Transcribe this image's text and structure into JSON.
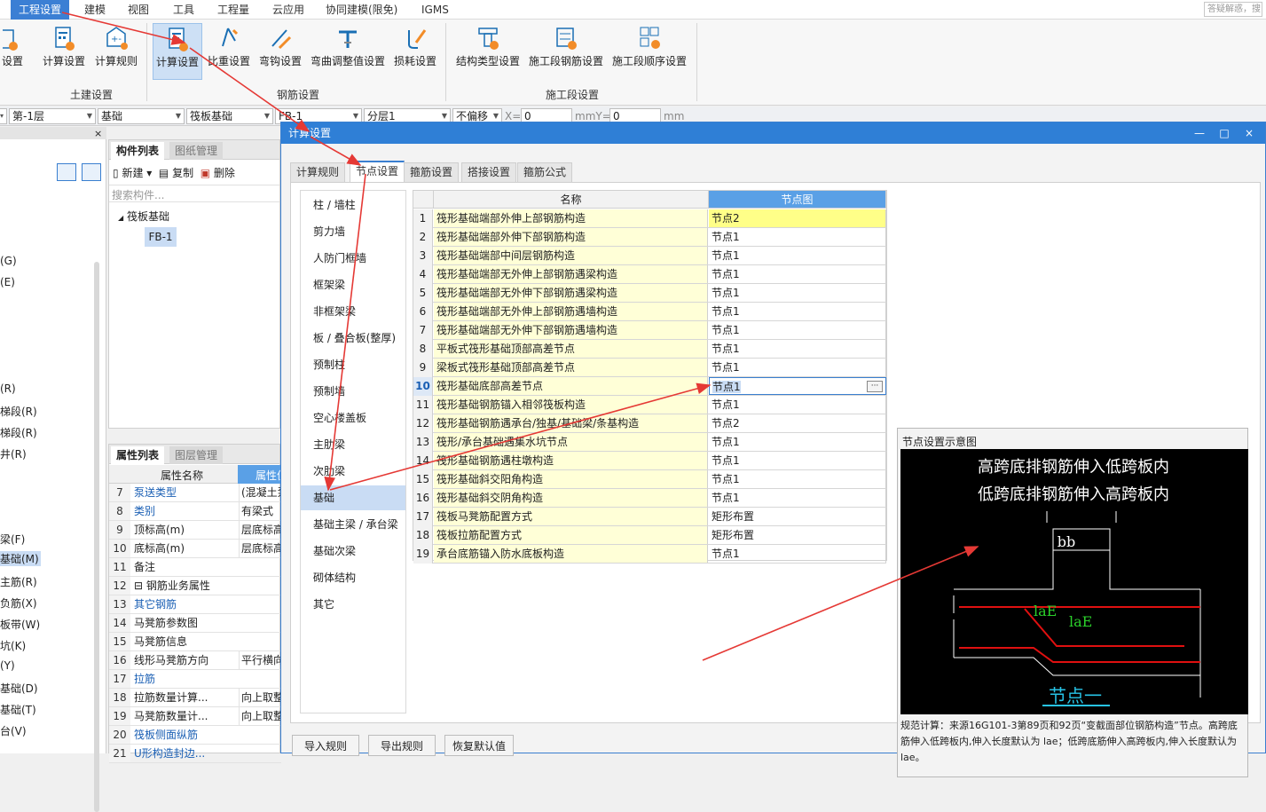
{
  "menubar": {
    "items": [
      "工程设置",
      "建模",
      "视图",
      "工具",
      "工程量",
      "云应用",
      "协同建模(限免)",
      "IGMS"
    ],
    "search_placeholder": "答疑解惑，搜"
  },
  "ribbon": {
    "buttons": [
      "设置",
      "计算设置",
      "计算规则",
      "计算设置",
      "比重设置",
      "弯钩设置",
      "弯曲调整值设置",
      "损耗设置",
      "结构类型设置",
      "施工段钢筋设置",
      "施工段顺序设置"
    ],
    "groups": [
      "土建设置",
      "钢筋设置",
      "施工段设置"
    ]
  },
  "combobar": {
    "floor": "第-1层",
    "category": "基础",
    "type": "筏板基础",
    "component": "FB-1",
    "layer": "分层1",
    "offset": "不偏移",
    "x_label": "X=",
    "x_value": "0",
    "mm_y_label": "mmY=",
    "y_value": "0",
    "mm_label": "mm"
  },
  "left_nav": {
    "close": "×",
    "items": [
      "(G)",
      "(E)",
      "(R)",
      "梯段(R)",
      "梯段(R)",
      "井(R)",
      "梁(F)",
      "基础(M)",
      "主筋(R)",
      "负筋(X)",
      "板带(W)",
      "坑(K)",
      "(Y)",
      "基础(D)",
      "基础(T)",
      "台(V)"
    ]
  },
  "component_list": {
    "tabs": [
      "构件列表",
      "图纸管理"
    ],
    "toolbar": [
      "新建",
      "复制",
      "删除"
    ],
    "search_placeholder": "搜索构件...",
    "tree_root": "筏板基础",
    "tree_child": "FB-1"
  },
  "props": {
    "tabs": [
      "属性列表",
      "图层管理"
    ],
    "header_name": "属性名称",
    "header_value": "属性值",
    "rows": [
      {
        "n": "7",
        "k": "泵送类型",
        "v": "(混凝土泵)"
      },
      {
        "n": "8",
        "k": "类别",
        "v": "有梁式"
      },
      {
        "n": "9",
        "k": "顶标高(m)",
        "v": "层底标高"
      },
      {
        "n": "10",
        "k": "底标高(m)",
        "v": "层底标高"
      },
      {
        "n": "11",
        "k": "备注",
        "v": ""
      },
      {
        "n": "12",
        "k": "⊟ 钢筋业务属性",
        "v": ""
      },
      {
        "n": "13",
        "k": "其它钢筋",
        "v": ""
      },
      {
        "n": "14",
        "k": "马凳筋参数图",
        "v": ""
      },
      {
        "n": "15",
        "k": "马凳筋信息",
        "v": ""
      },
      {
        "n": "16",
        "k": "线形马凳筋方向",
        "v": "平行横向"
      },
      {
        "n": "17",
        "k": "拉筋",
        "v": ""
      },
      {
        "n": "18",
        "k": "拉筋数量计算...",
        "v": "向上取整"
      },
      {
        "n": "19",
        "k": "马凳筋数量计...",
        "v": "向上取整"
      },
      {
        "n": "20",
        "k": "筏板侧面纵筋",
        "v": ""
      },
      {
        "n": "21",
        "k": "U形构造封边...",
        "v": ""
      }
    ]
  },
  "dialog": {
    "title": "计算设置",
    "win_buttons": [
      "—",
      "□",
      "×"
    ],
    "tabs": [
      "计算规则",
      "节点设置",
      "箍筋设置",
      "搭接设置",
      "箍筋公式"
    ],
    "categories": [
      "柱 / 墙柱",
      "剪力墙",
      "人防门框墙",
      "框架梁",
      "非框架梁",
      "板 / 叠合板(整厚)",
      "预制柱",
      "预制墙",
      "空心楼盖板",
      "主肋梁",
      "次肋梁",
      "基础",
      "基础主梁 / 承台梁",
      "基础次梁",
      "砌体结构",
      "其它"
    ],
    "grid_header_name": "名称",
    "grid_header_node": "节点图",
    "rows": [
      {
        "n": "1",
        "name": "筏形基础端部外伸上部钢筋构造",
        "node": "节点2"
      },
      {
        "n": "2",
        "name": "筏形基础端部外伸下部钢筋构造",
        "node": "节点1"
      },
      {
        "n": "3",
        "name": "筏形基础端部中间层钢筋构造",
        "node": "节点1"
      },
      {
        "n": "4",
        "name": "筏形基础端部无外伸上部钢筋遇梁构造",
        "node": "节点1"
      },
      {
        "n": "5",
        "name": "筏形基础端部无外伸下部钢筋遇梁构造",
        "node": "节点1"
      },
      {
        "n": "6",
        "name": "筏形基础端部无外伸上部钢筋遇墙构造",
        "node": "节点1"
      },
      {
        "n": "7",
        "name": "筏形基础端部无外伸下部钢筋遇墙构造",
        "node": "节点1"
      },
      {
        "n": "8",
        "name": "平板式筏形基础顶部高差节点",
        "node": "节点1"
      },
      {
        "n": "9",
        "name": "梁板式筏形基础顶部高差节点",
        "node": "节点1"
      },
      {
        "n": "10",
        "name": "筏形基础底部高差节点",
        "node": "节点1"
      },
      {
        "n": "11",
        "name": "筏形基础钢筋锚入相邻筏板构造",
        "node": "节点1"
      },
      {
        "n": "12",
        "name": "筏形基础钢筋遇承台/独基/基础梁/条基构造",
        "node": "节点2"
      },
      {
        "n": "13",
        "name": "筏形/承台基础遇集水坑节点",
        "node": "节点1"
      },
      {
        "n": "14",
        "name": "筏形基础钢筋遇柱墩构造",
        "node": "节点1"
      },
      {
        "n": "15",
        "name": "筏形基础斜交阳角构造",
        "node": "节点1"
      },
      {
        "n": "16",
        "name": "筏形基础斜交阴角构造",
        "node": "节点1"
      },
      {
        "n": "17",
        "name": "筏板马凳筋配置方式",
        "node": "矩形布置"
      },
      {
        "n": "18",
        "name": "筏板拉筋配置方式",
        "node": "矩形布置"
      },
      {
        "n": "19",
        "name": "承台底筋锚入防水底板构造",
        "node": "节点1"
      }
    ],
    "ellipsis": "···",
    "preview": {
      "title": "节点设置示意图",
      "line1": "高跨底排钢筋伸入低跨板内",
      "line2": "低跨底排钢筋伸入高跨板内",
      "dim_bb": "bb",
      "lae1": "laE",
      "lae2": "laE",
      "node_label": "节点一",
      "desc": "规范计算：来源16G101-3第89页和92页“变截面部位钢筋构造”节点。高跨底筋伸入低跨板内,伸入长度默认为 lae；低跨底筋伸入高跨板内,伸入长度默认为 lae。"
    },
    "buttons": [
      "导入规则",
      "导出规则",
      "恢复默认值"
    ]
  },
  "colors": {
    "accent": "#3b7fd4",
    "title_bar": "#2f7fd6",
    "arrow": "#e53935",
    "name_cell": "#ffffd7",
    "highlight": "#ffff88"
  }
}
